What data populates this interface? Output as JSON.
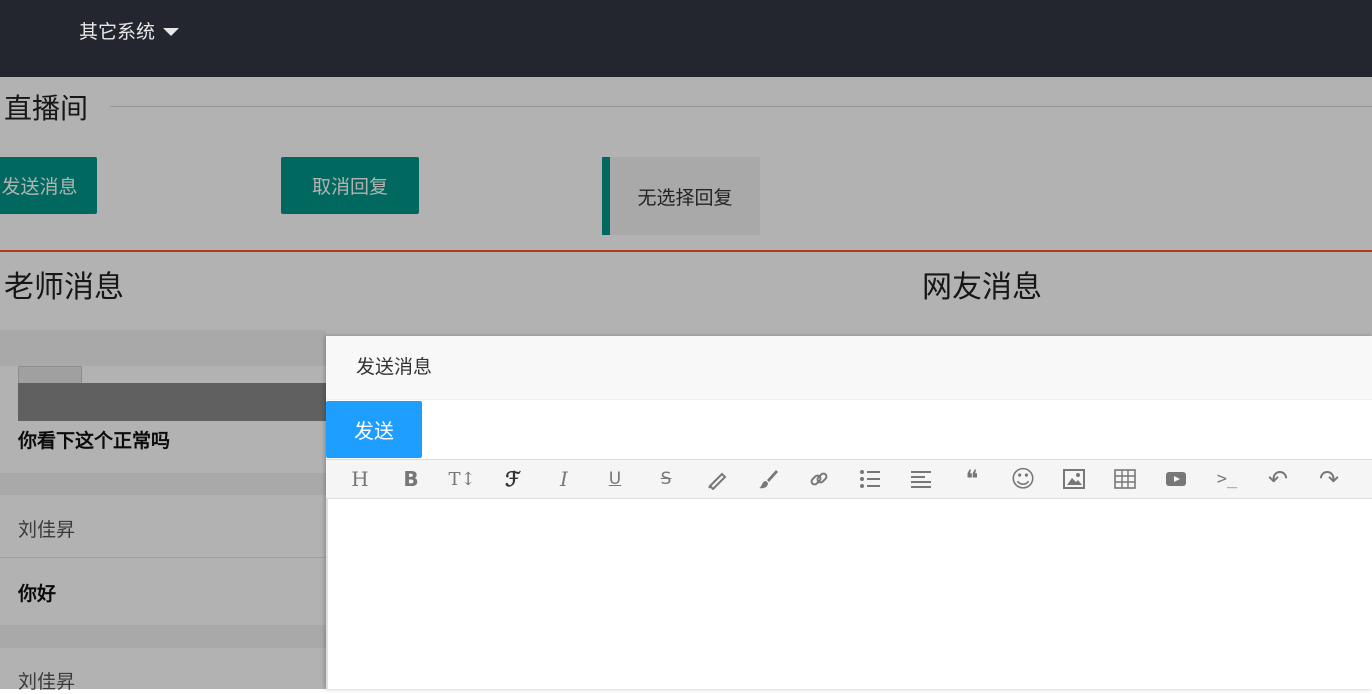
{
  "nav": {
    "other_systems": "其它系统"
  },
  "live": {
    "title": "直播间",
    "send_button": "发送消息",
    "cancel_reply_button": "取消回复",
    "reply_status": "无选择回复",
    "teacher_heading": "老师消息",
    "netizen_heading": "网友消息"
  },
  "messages": [
    {
      "name": "",
      "text": "你看下这个正常吗"
    },
    {
      "name": "刘佳昇",
      "text": "你好"
    },
    {
      "name": "刘佳昇",
      "text": ""
    }
  ],
  "modal": {
    "title": "发送消息",
    "send": "发送"
  },
  "toolbar": [
    {
      "icon": "heading-icon",
      "glyph": "H"
    },
    {
      "icon": "bold-icon",
      "glyph": "B"
    },
    {
      "icon": "font-size-icon",
      "glyph": "T↕"
    },
    {
      "icon": "font-family-icon",
      "glyph": "ℱ"
    },
    {
      "icon": "italic-icon",
      "glyph": "I"
    },
    {
      "icon": "underline-icon",
      "glyph": "U"
    },
    {
      "icon": "strikethrough-icon",
      "glyph": "S"
    },
    {
      "icon": "highlight-pen-icon",
      "glyph": ""
    },
    {
      "icon": "brush-icon",
      "glyph": ""
    },
    {
      "icon": "link-icon",
      "glyph": ""
    },
    {
      "icon": "bullet-list-icon",
      "glyph": ""
    },
    {
      "icon": "align-icon",
      "glyph": ""
    },
    {
      "icon": "quote-icon",
      "glyph": "❝"
    },
    {
      "icon": "emoji-icon",
      "glyph": "☺"
    },
    {
      "icon": "image-icon",
      "glyph": ""
    },
    {
      "icon": "table-icon",
      "glyph": ""
    },
    {
      "icon": "video-icon",
      "glyph": ""
    },
    {
      "icon": "code-icon",
      "glyph": ">_"
    },
    {
      "icon": "undo-icon",
      "glyph": "↶"
    },
    {
      "icon": "redo-icon",
      "glyph": "↷"
    }
  ],
  "colors": {
    "nav_bg": "#23262e",
    "primary_green": "#009688",
    "send_blue": "#1e9fff",
    "accent_red": "#ff5722"
  }
}
